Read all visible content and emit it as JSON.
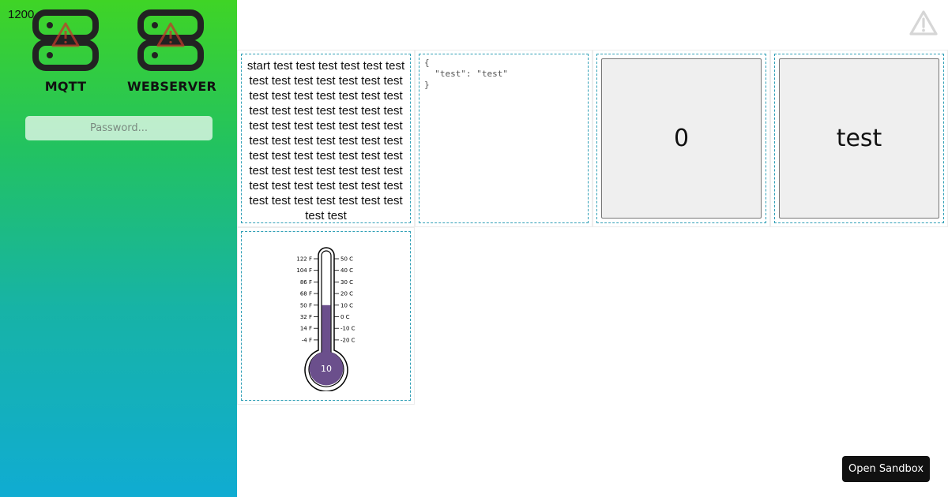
{
  "viewport": {
    "width_readout": "1200"
  },
  "sidebar": {
    "services": [
      {
        "label": "MQTT",
        "icon": "server-warning-icon",
        "status": "warning"
      },
      {
        "label": "WEBSERVER",
        "icon": "server-warning-icon",
        "status": "warning"
      }
    ],
    "password": {
      "placeholder": "Password...",
      "value": ""
    }
  },
  "header": {
    "warning_icon": "warning-triangle-icon"
  },
  "widgets": {
    "text": {
      "content": "start test test test test test test test test test test test test test test test test test test test test test test test test test test test test test test test test test test test test test test test test test test test test test test test test test test test test test test test test test test test test test test test test test test test test test test test"
    },
    "json": {
      "content": "{\n  \"test\": \"test\"\n}"
    },
    "button_number": {
      "label": "0"
    },
    "button_text": {
      "label": "test"
    },
    "thermometer": {
      "value": 10,
      "value_label": "10",
      "fahrenheit_ticks": [
        "122 F",
        "104 F",
        "86 F",
        "68 F",
        "50 F",
        "32 F",
        "14 F",
        "-4 F"
      ],
      "celsius_ticks": [
        "50 C",
        "40 C",
        "30 C",
        "20 C",
        "10 C",
        "0 C",
        "-10 C",
        "-20 C"
      ],
      "fill_color": "#6b4f8c"
    }
  },
  "sandbox": {
    "label": "Open Sandbox"
  },
  "colors": {
    "accent_warning": "#c0392b",
    "icon_dark": "#222222",
    "grid_border": "#2f9fb6"
  }
}
